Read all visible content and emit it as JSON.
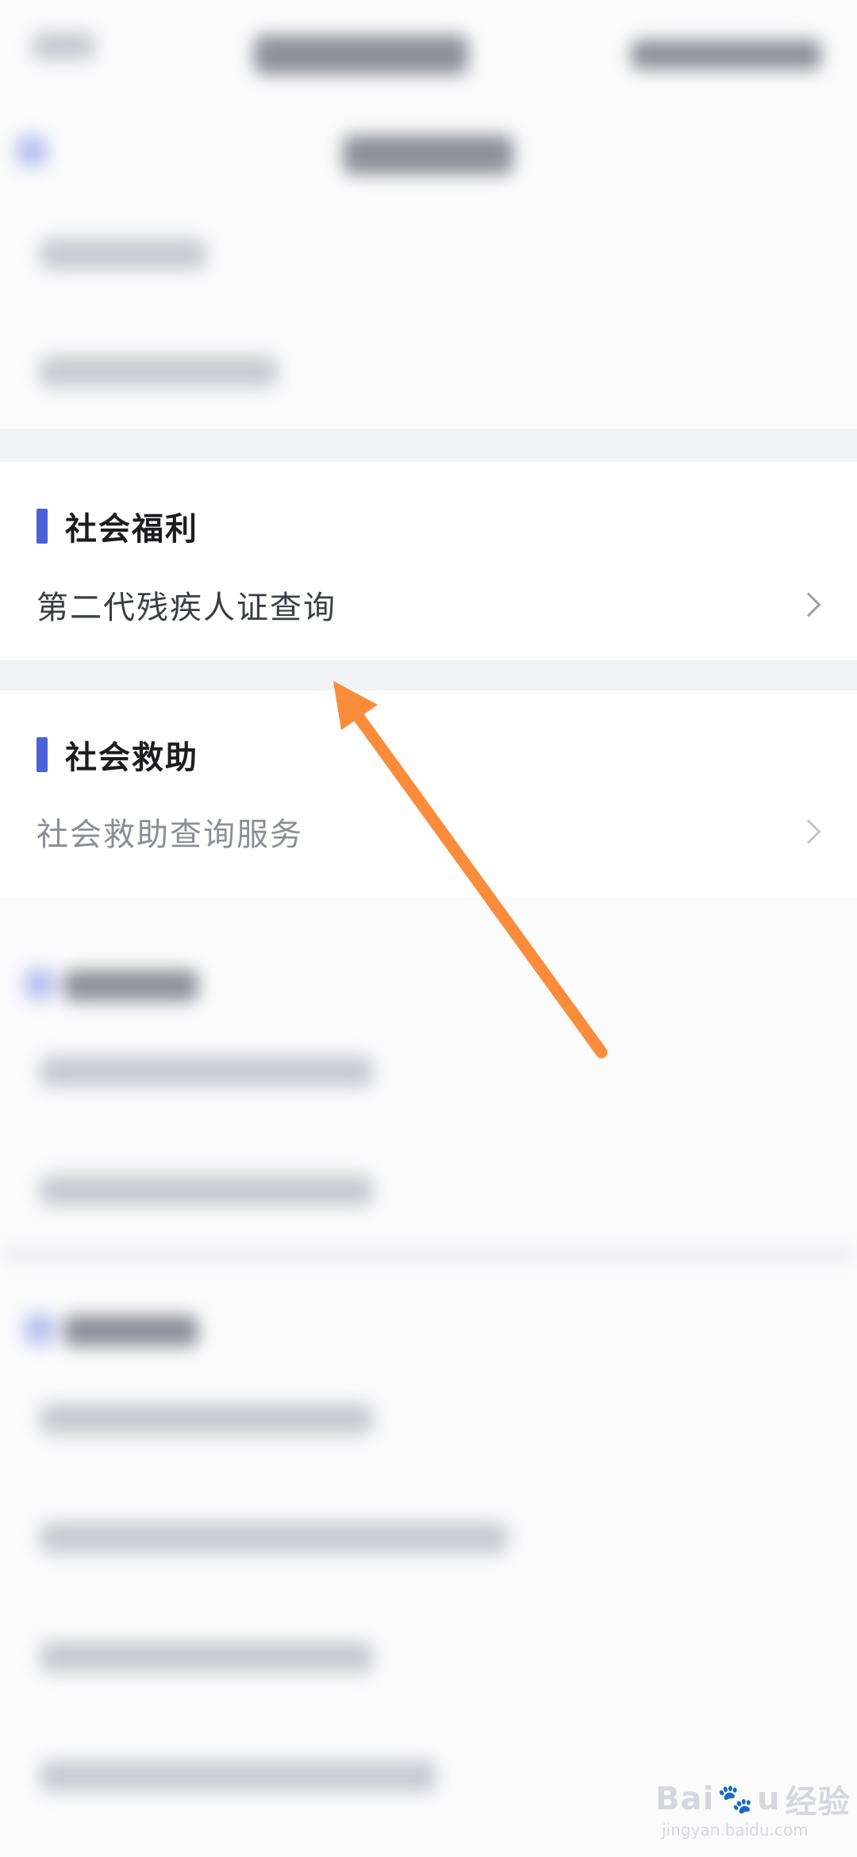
{
  "sections": {
    "welfare": {
      "title": "社会福利",
      "items": [
        {
          "label": "第二代残疾人证查询"
        }
      ]
    },
    "assistance": {
      "title": "社会救助",
      "items": [
        {
          "label": "社会救助查询服务"
        }
      ]
    }
  },
  "colors": {
    "accent": "#4a62d6",
    "annotation_arrow": "#fa8c3c"
  },
  "watermark": {
    "brand": "Bai",
    "brand_end": "u",
    "paw": "🐾",
    "cn": "经验",
    "url": "jingyan.baidu.com"
  }
}
